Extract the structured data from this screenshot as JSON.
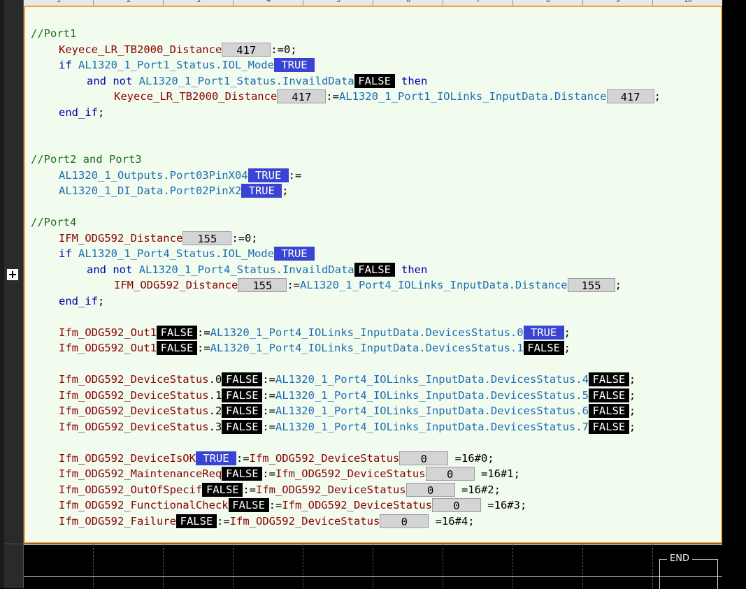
{
  "ruler": {
    "ticks": [
      "1",
      "2",
      "3",
      "4",
      "5",
      "6",
      "7",
      "8",
      "9",
      "10"
    ]
  },
  "code": {
    "port1": {
      "comment": "//Port1",
      "l1_var": "Keyece_LR_TB2000_Distance",
      "l1_mon": "417",
      "l1_rest": ":=0;",
      "l2_if": "if",
      "l2_var": "AL1320_1_Port1_Status.IOL_Mode",
      "l2_mon": "TRUE",
      "l3_and": "and",
      "l3_not": "not",
      "l3_var": "AL1320_1_Port1_Status.InvaildData",
      "l3_mon": "FALSE",
      "l3_then": "then",
      "l4_var": "Keyece_LR_TB2000_Distance",
      "l4_mon": "417",
      "l4_op": ":=",
      "l4_src": "AL1320_1_Port1_IOLinks_InputData.Distance",
      "l4_mon2": "417",
      "l4_end": ";",
      "l5_endif": "end_if",
      "l5_semi": ";"
    },
    "port23": {
      "comment": "//Port2 and Port3",
      "l1_var": "AL1320_1_Outputs.Port03PinX04",
      "l1_mon": "TRUE",
      "l1_op": ":=",
      "l2_var": "AL1320_1_DI_Data.Port02PinX2",
      "l2_mon": "TRUE",
      "l2_end": ";"
    },
    "port4": {
      "comment": "//Port4",
      "l1_var": "IFM_ODG592_Distance",
      "l1_mon": "155",
      "l1_rest": ":=0;",
      "l2_if": "if",
      "l2_var": "AL1320_1_Port4_Status.IOL_Mode",
      "l2_mon": "TRUE",
      "l3_and": "and",
      "l3_not": "not",
      "l3_var": "AL1320_1_Port4_Status.InvaildData",
      "l3_mon": "FALSE",
      "l3_then": "then",
      "l4_var": "IFM_ODG592_Distance",
      "l4_mon": "155",
      "l4_op": ":=",
      "l4_src": "AL1320_1_Port4_IOLinks_InputData.Distance",
      "l4_mon2": "155",
      "l4_end": ";",
      "l5_endif": "end_if",
      "l5_semi": ";"
    },
    "out": [
      {
        "var": "Ifm_ODG592_Out1",
        "mon": "FALSE",
        "op": ":=",
        "src": "AL1320_1_Port4_IOLinks_InputData.DevicesStatus",
        "bit": ".0",
        "mon2": "TRUE",
        "end": ";"
      },
      {
        "var": "Ifm_ODG592_Out1",
        "mon": "FALSE",
        "op": ":=",
        "src": "AL1320_1_Port4_IOLinks_InputData.DevicesStatus",
        "bit": ".1",
        "mon2": "FALSE",
        "end": ";"
      }
    ],
    "devstat": [
      {
        "var": "Ifm_ODG592_DeviceStatus",
        "bit": ".0",
        "mon": "FALSE",
        "op": ":=",
        "src": "AL1320_1_Port4_IOLinks_InputData.DevicesStatus",
        "sbit": ".4",
        "mon2": "FALSE",
        "end": ";"
      },
      {
        "var": "Ifm_ODG592_DeviceStatus",
        "bit": ".1",
        "mon": "FALSE",
        "op": ":=",
        "src": "AL1320_1_Port4_IOLinks_InputData.DevicesStatus",
        "sbit": ".5",
        "mon2": "FALSE",
        "end": ";"
      },
      {
        "var": "Ifm_ODG592_DeviceStatus",
        "bit": ".2",
        "mon": "FALSE",
        "op": ":=",
        "src": "AL1320_1_Port4_IOLinks_InputData.DevicesStatus",
        "sbit": ".6",
        "mon2": "FALSE",
        "end": ";"
      },
      {
        "var": "Ifm_ODG592_DeviceStatus",
        "bit": ".3",
        "mon": "FALSE",
        "op": ":=",
        "src": "AL1320_1_Port4_IOLinks_InputData.DevicesStatus",
        "sbit": ".7",
        "mon2": "FALSE",
        "end": ";"
      }
    ],
    "flags": [
      {
        "var": "Ifm_ODG592_DeviceIsOK",
        "mon": "TRUE",
        "op": ":=",
        "src": "Ifm_ODG592_DeviceStatus",
        "mon2": "0",
        "cmp": "=16#0;"
      },
      {
        "var": "Ifm_ODG592_MaintenanceReq",
        "mon": "FALSE",
        "op": ":=",
        "src": "Ifm_ODG592_DeviceStatus",
        "mon2": "0",
        "cmp": "=16#1;"
      },
      {
        "var": "Ifm_ODG592_OutOfSpecif",
        "mon": "FALSE",
        "op": ":=",
        "src": "Ifm_ODG592_DeviceStatus",
        "mon2": "0",
        "cmp": "=16#2;"
      },
      {
        "var": "Ifm_ODG592_FunctionalCheck",
        "mon": "FALSE",
        "op": ":=",
        "src": "Ifm_ODG592_DeviceStatus",
        "mon2": "0",
        "cmp": "=16#3;"
      },
      {
        "var": "Ifm_ODG592_Failure",
        "mon": "FALSE",
        "op": ":=",
        "src": "Ifm_ODG592_DeviceStatus",
        "mon2": "0",
        "cmp": "=16#4;"
      }
    ]
  },
  "ladder": {
    "end_label": "END"
  },
  "colors": {
    "comment": "#1c6d1c",
    "keyword": "#0000aa",
    "local_var": "#8b0000",
    "global_var": "#1d6db4",
    "true_bg": "#3a44d2",
    "false_bg": "#000000",
    "num_bg": "#d4d4d4",
    "border": "#f2a33a"
  }
}
